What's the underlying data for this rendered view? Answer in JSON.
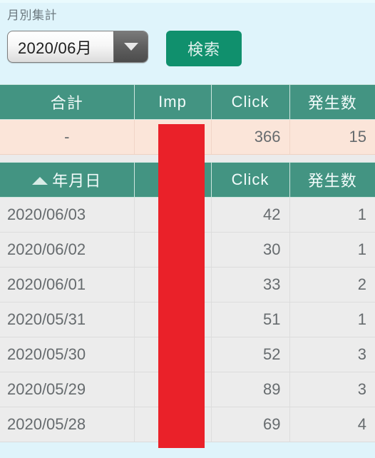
{
  "page": {
    "title": "月別集計",
    "background_color": "#dff4fb"
  },
  "controls": {
    "month_select": {
      "selected": "2020/06月",
      "icon": "chevron-down-icon"
    },
    "search_button": {
      "label": "検索",
      "color": "#10906d"
    }
  },
  "total_table": {
    "headers": [
      "合計",
      "Imp",
      "Click",
      "発生数"
    ],
    "row": {
      "label": "-",
      "imp": "",
      "click": "366",
      "occurrences": "15"
    },
    "row_color": "#fbe5d9",
    "header_color": "#439482"
  },
  "detail_table": {
    "headers": [
      "年月日",
      "",
      "Click",
      "発生数"
    ],
    "sort": {
      "column": "年月日",
      "direction": "ascending",
      "icon": "sort-ascending-icon"
    },
    "rows": [
      {
        "date": "2020/06/03",
        "imp": "",
        "click": "42",
        "occurrences": "1"
      },
      {
        "date": "2020/06/02",
        "imp": "",
        "click": "30",
        "occurrences": "1"
      },
      {
        "date": "2020/06/01",
        "imp": "",
        "click": "33",
        "occurrences": "2"
      },
      {
        "date": "2020/05/31",
        "imp": "",
        "click": "51",
        "occurrences": "1"
      },
      {
        "date": "2020/05/30",
        "imp": "",
        "click": "52",
        "occurrences": "3"
      },
      {
        "date": "2020/05/29",
        "imp": "",
        "click": "89",
        "occurrences": "3"
      },
      {
        "date": "2020/05/28",
        "imp": "",
        "click": "69",
        "occurrences": "4"
      }
    ]
  },
  "redaction": {
    "color": "#ea2129",
    "covers_column": "Imp"
  }
}
